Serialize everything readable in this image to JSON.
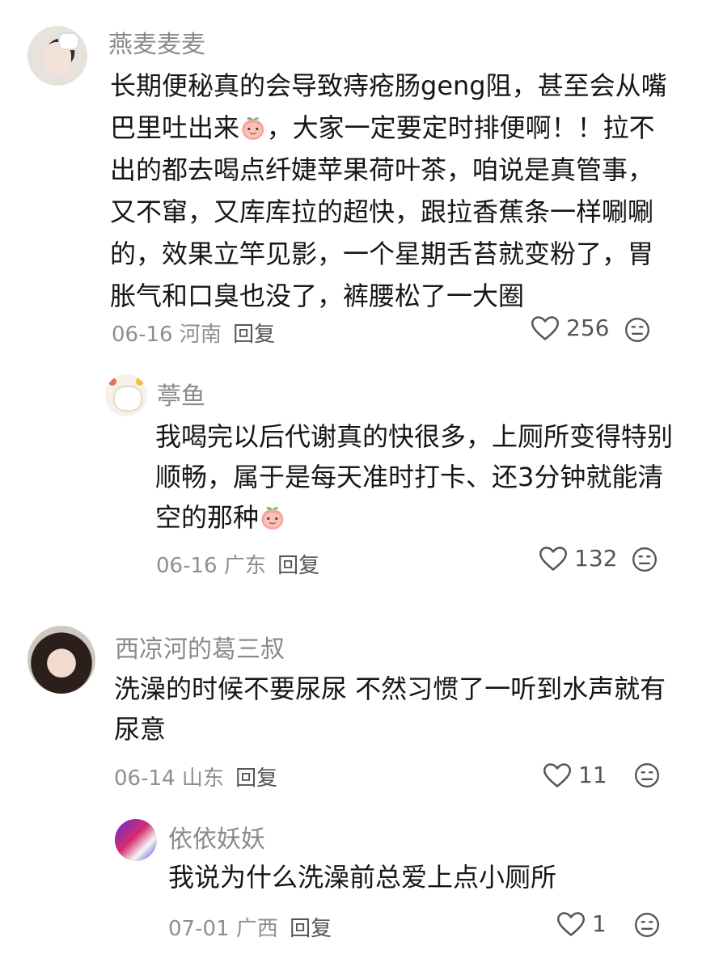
{
  "comments": [
    {
      "username": "燕麦麦麦",
      "text_parts": [
        "长期便秘真的会导致痔疮肠geng阻，甚至会从嘴巴里吐出来",
        "，大家一定要定时排便啊！！拉不出的都去喝点纤婕苹果荷叶茶，咱说是真管事，又不窜，又库库拉的超快，跟拉香蕉条一样唰唰的，效果立竿见影，一个星期舌苔就变粉了，胃胀气和口臭也没了，裤腰松了一大圈"
      ],
      "date": "06-16",
      "location": "河南",
      "reply_label": "回复",
      "likes": "256"
    },
    {
      "username": "葶鱼",
      "text_parts": [
        "我喝完以后代谢真的快很多，上厕所变得特别顺畅，属于是每天准时打卡、还3分钟就能清空的那种"
      ],
      "date": "06-16",
      "location": "广东",
      "reply_label": "回复",
      "likes": "132"
    },
    {
      "username": "西凉河的葛三叔",
      "text_parts": [
        "洗澡的时候不要尿尿 不然习惯了一听到水声就有尿意"
      ],
      "date": "06-14",
      "location": "山东",
      "reply_label": "回复",
      "likes": "11"
    },
    {
      "username": "依依妖妖",
      "text_parts": [
        "我说为什么洗澡前总爱上点小厕所"
      ],
      "date": "07-01",
      "location": "广西",
      "reply_label": "回复",
      "likes": "1"
    }
  ],
  "colors": {
    "username": "#8a8a8a",
    "text": "#161616",
    "meta": "#8e8e8e",
    "icon": "#555555"
  }
}
